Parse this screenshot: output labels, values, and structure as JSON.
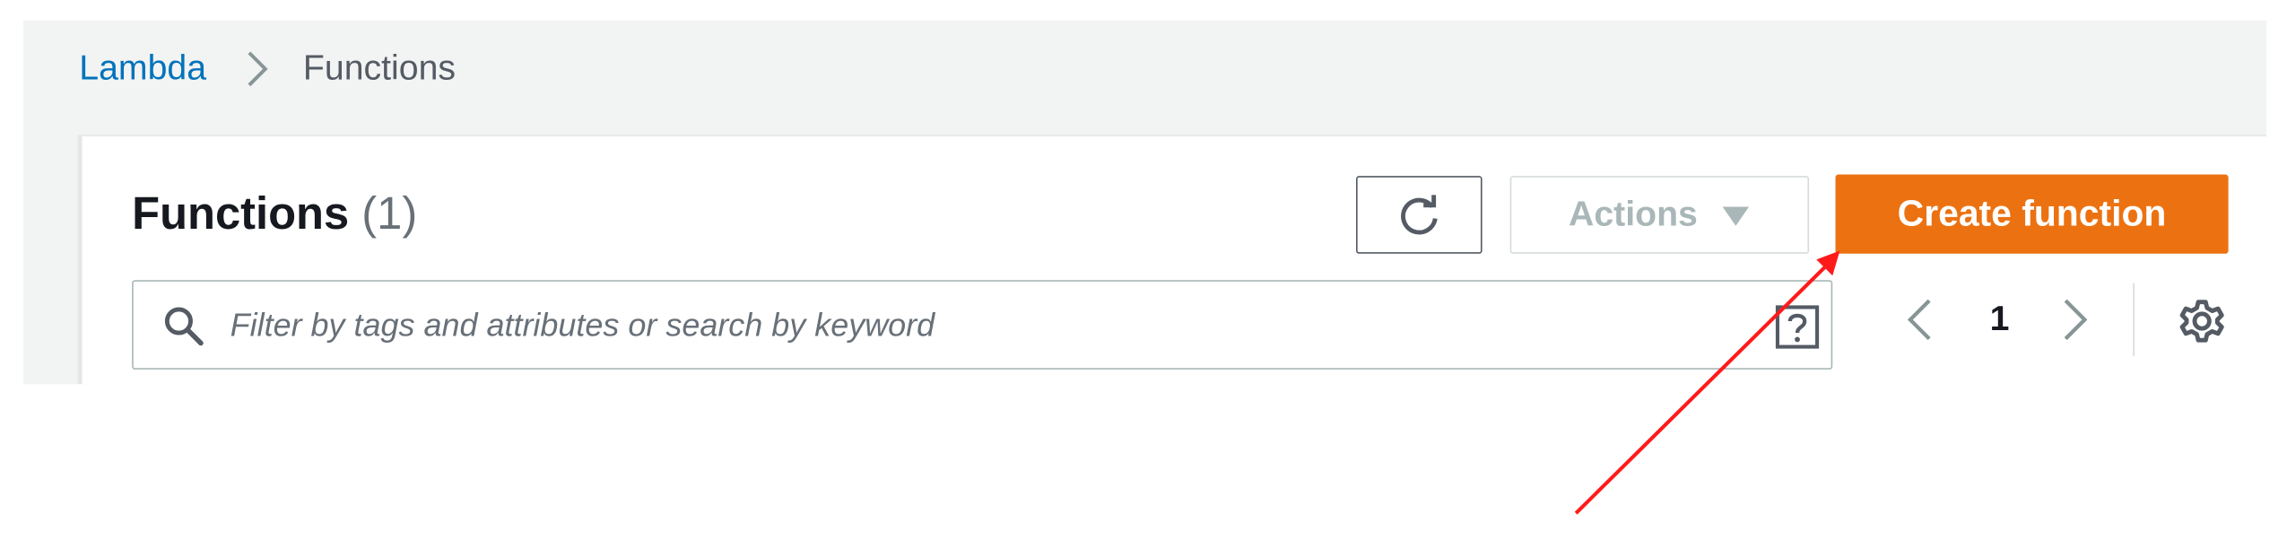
{
  "breadcrumb": {
    "items": [
      {
        "label": "Lambda"
      },
      {
        "label": "Functions"
      }
    ]
  },
  "header": {
    "title": "Functions",
    "count": "(1)"
  },
  "toolbar": {
    "refresh_icon": "refresh-icon",
    "actions_label": "Actions",
    "create_label": "Create function"
  },
  "search": {
    "value": "",
    "placeholder": "Filter by tags and attributes or search by keyword"
  },
  "pagination": {
    "current_page": "1"
  },
  "colors": {
    "primary": "#ec7211",
    "link": "#0073bb",
    "annotation_arrow": "#ff1a1a"
  }
}
